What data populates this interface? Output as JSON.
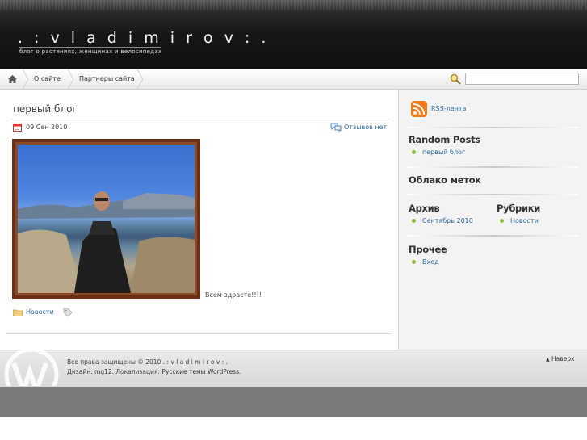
{
  "header": {
    "site_title": ". : v l a d i m i r o v : .",
    "tagline": "блог о растениях, женщинах и велосипедах"
  },
  "nav": {
    "items": [
      {
        "label": "О сайте"
      },
      {
        "label": "Партнеры сайта"
      }
    ],
    "search_value": ""
  },
  "post": {
    "title": "первый блог",
    "date": "09 Сен 2010",
    "comments": "Отзывов нет",
    "text": "Всем здрасте!!!!",
    "category": "Новости"
  },
  "sidebar": {
    "rss_label": "RSS-лента",
    "random_posts": {
      "title": "Random Posts",
      "items": [
        "первый блог"
      ]
    },
    "tag_cloud": {
      "title": "Облако меток"
    },
    "archive": {
      "title": "Архив",
      "items": [
        "Сентябрь 2010"
      ]
    },
    "categories": {
      "title": "Рубрики",
      "items": [
        "Новости"
      ]
    },
    "other": {
      "title": "Прочее",
      "items": [
        "Вход"
      ]
    }
  },
  "footer": {
    "line1": "Все права защищены © 2010 . : v l a d i m i r o v : .",
    "line2_prefix": "Дизайн: ",
    "designer": "mg12",
    "line2_mid": ". Локализация: ",
    "localization": "Русские темы WordPress",
    "line2_suffix": ".",
    "back_to_top": "Наверх"
  },
  "colors": {
    "link": "#2a6aa5",
    "bullet": "#8bbf3a",
    "header_bg": "#171717"
  }
}
